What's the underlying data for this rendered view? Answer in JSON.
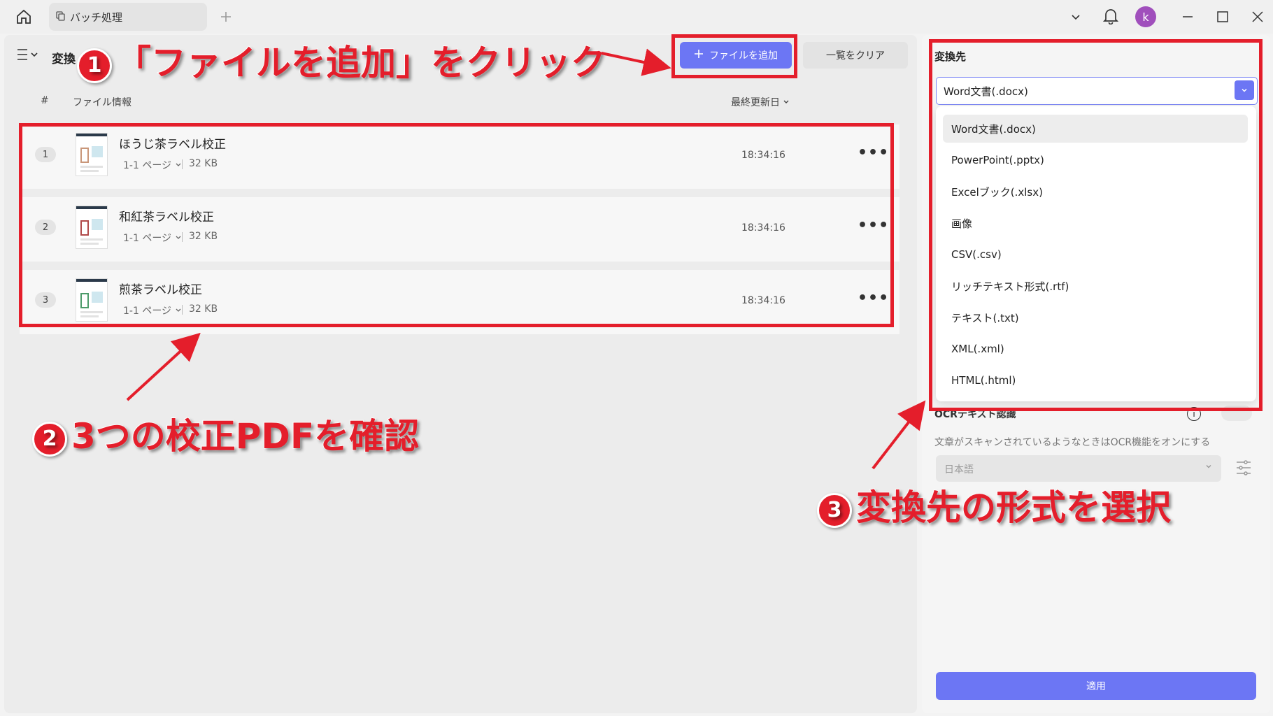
{
  "titlebar": {
    "tab_label": "バッチ処理",
    "avatar_letter": "k"
  },
  "toolbar": {
    "title": "変換",
    "add_files_label": "ファイルを追加",
    "clear_list_label": "一覧をクリア"
  },
  "table": {
    "col_number": "#",
    "col_file_info": "ファイル情報",
    "col_modified": "最終更新日"
  },
  "files": [
    {
      "index": "1",
      "name": "ほうじ茶ラベル校正",
      "pages": "1-1 ページ",
      "size": "32 KB",
      "time": "18:34:16",
      "accent": "#c9977a"
    },
    {
      "index": "2",
      "name": "和紅茶ラベル校正",
      "pages": "1-1 ページ",
      "size": "32 KB",
      "time": "18:34:16",
      "accent": "#b04a4a"
    },
    {
      "index": "3",
      "name": "煎茶ラベル校正",
      "pages": "1-1 ページ",
      "size": "32 KB",
      "time": "18:34:16",
      "accent": "#4d9b6a"
    }
  ],
  "convert_panel": {
    "label": "変換先",
    "selected": "Word文書(.docx)",
    "options": [
      "Word文書(.docx)",
      "PowerPoint(.pptx)",
      "Excelブック(.xlsx)",
      "画像",
      "CSV(.csv)",
      "リッチテキスト形式(.rtf)",
      "テキスト(.txt)",
      "XML(.xml)",
      "HTML(.html)"
    ],
    "ocr_title": "OCRテキスト認識",
    "ocr_description": "文章がスキャンされているようなときはOCR機能をオンにする",
    "ocr_language": "日本語",
    "apply_label": "適用"
  },
  "annotations": {
    "step1_num": "1",
    "step1_text": "「ファイルを追加」をクリック",
    "step2_num": "2",
    "step2_text": "3つの校正PDFを確認",
    "step3_num": "3",
    "step3_text": "変換先の形式を選択"
  },
  "colors": {
    "accent": "#6c76f4",
    "annotation_red": "#e41e2b",
    "avatar": "#a04fbc"
  }
}
